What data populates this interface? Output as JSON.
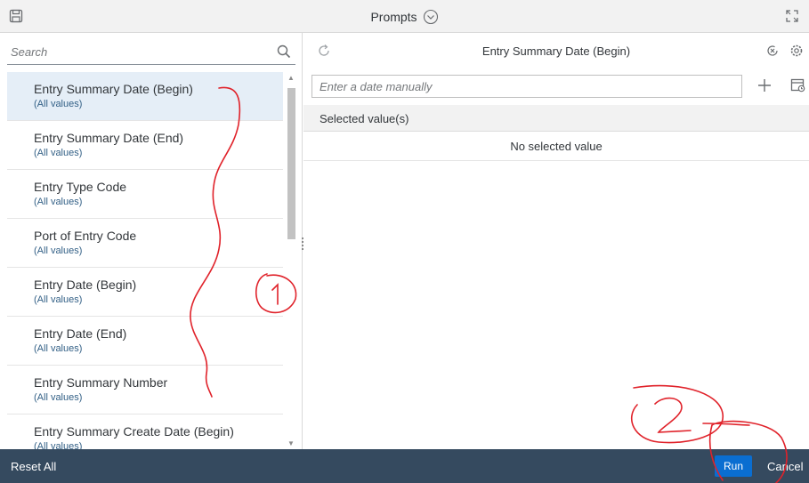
{
  "header": {
    "title": "Prompts",
    "icons": {
      "save": "save-icon",
      "title_toggle": "chevron-down-circle-icon",
      "expand": "expand-icon"
    }
  },
  "left_panel": {
    "search": {
      "placeholder": "Search",
      "icon": "search-icon"
    },
    "items": [
      {
        "label": "Entry Summary Date (Begin)",
        "sub": "(All values)",
        "selected": true
      },
      {
        "label": "Entry Summary Date (End)",
        "sub": "(All values)"
      },
      {
        "label": "Entry Type Code",
        "sub": "(All values)"
      },
      {
        "label": "Port of Entry Code",
        "sub": "(All values)"
      },
      {
        "label": "Entry Date (Begin)",
        "sub": "(All values)"
      },
      {
        "label": "Entry Date (End)",
        "sub": "(All values)"
      },
      {
        "label": "Entry Summary Number",
        "sub": "(All values)"
      },
      {
        "label": "Entry Summary Create Date (Begin)",
        "sub": "(All values)"
      }
    ]
  },
  "right_panel": {
    "title": "Entry Summary Date (Begin)",
    "date_input": {
      "placeholder": "Enter a date manually"
    },
    "selected_header": "Selected value(s)",
    "empty_message": "No selected value",
    "icons": {
      "refresh": "refresh-icon",
      "clear": "clear-icon",
      "settings": "settings-icon",
      "add": "plus-icon",
      "calendar": "calendar-icon"
    }
  },
  "footer": {
    "reset_label": "Reset All",
    "run_label": "Run",
    "cancel_label": "Cancel"
  },
  "colors": {
    "footer_bg": "#354a5f",
    "run_button": "#0a6ed1",
    "selected_row": "#e5eef7",
    "annotation": "#e0222a"
  }
}
